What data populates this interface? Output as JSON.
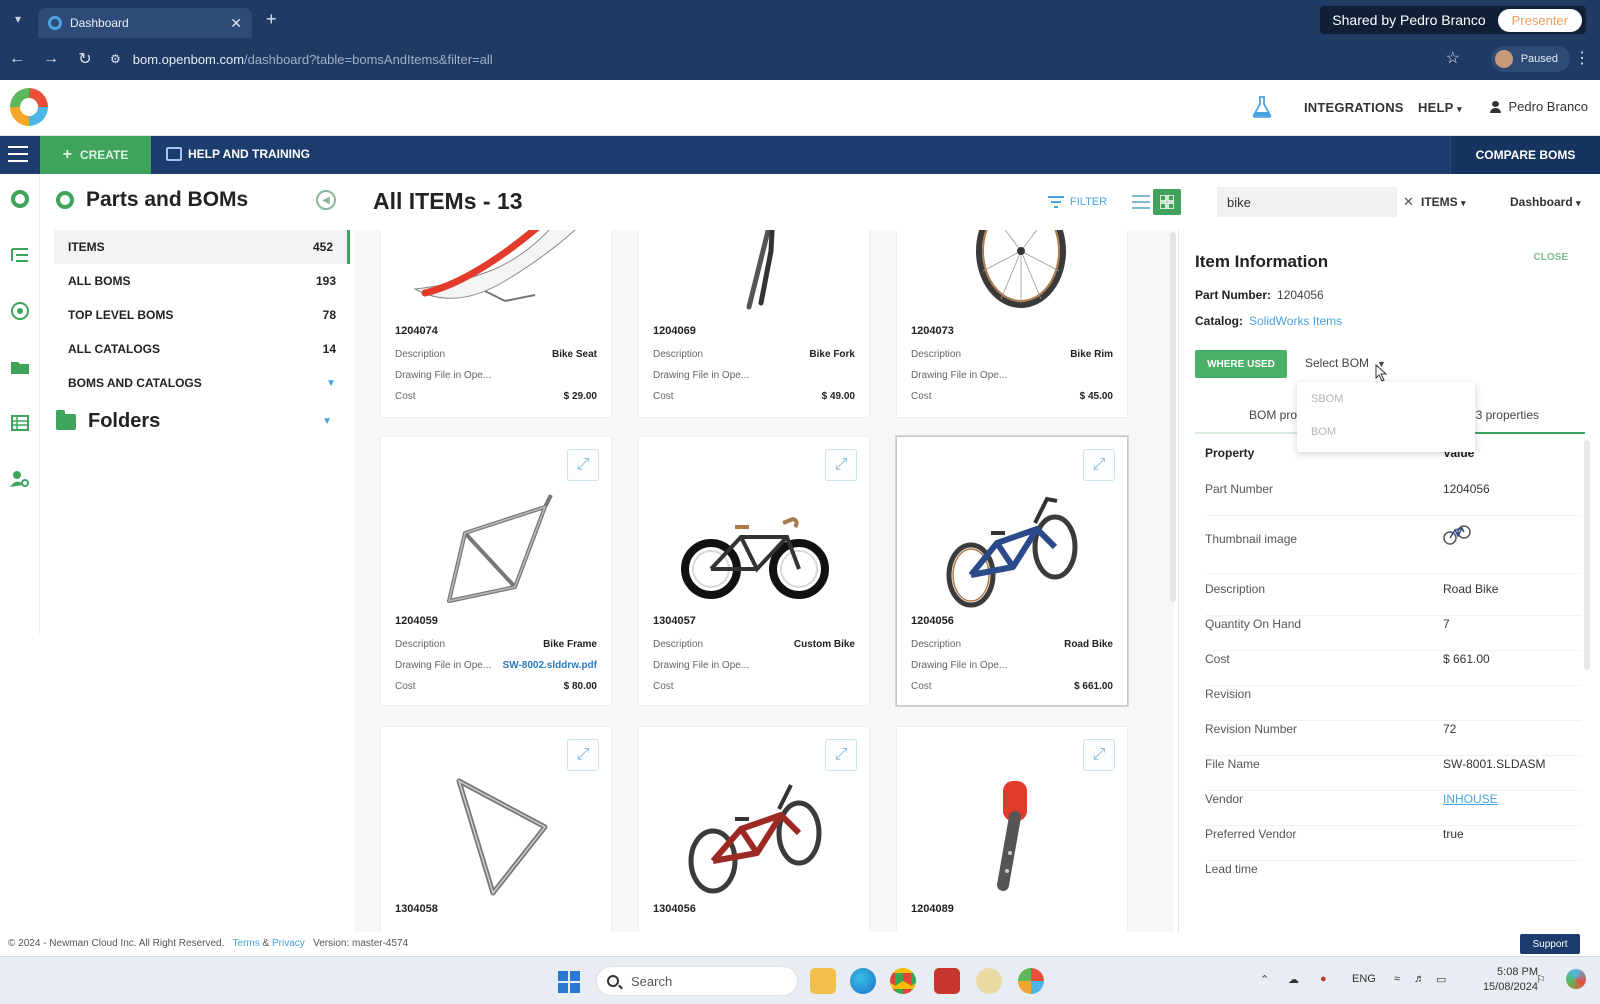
{
  "browser": {
    "tab_title": "Dashboard",
    "url_main": "bom.openbom.com",
    "url_rest": "/dashboard?table=bomsAndItems&filter=all",
    "shared_by": "Shared by Pedro Branco",
    "presenter": "Presenter",
    "profile_status": "Paused"
  },
  "header": {
    "integrations": "INTEGRATIONS",
    "help": "HELP",
    "user": "Pedro Branco"
  },
  "toolbar": {
    "create": "CREATE",
    "help_training": "HELP AND TRAINING",
    "compare_boms": "COMPARE BOMS"
  },
  "sidebar": {
    "title": "Parts and BOMs",
    "items": [
      {
        "label": "ITEMS",
        "count": "452"
      },
      {
        "label": "ALL BOMS",
        "count": "193"
      },
      {
        "label": "TOP LEVEL BOMS",
        "count": "78"
      },
      {
        "label": "ALL CATALOGS",
        "count": "14"
      },
      {
        "label": "BOMS AND CATALOGS",
        "count": ""
      }
    ],
    "folders": "Folders"
  },
  "main": {
    "title": "All ITEMs - 13",
    "filter": "FILTER",
    "search_value": "bike",
    "items_dd": "ITEMS",
    "dashboard_dd": "Dashboard"
  },
  "cards": [
    {
      "pn": "1204074",
      "desc": "Bike Seat",
      "drawing": "Drawing File in Ope...",
      "drawing_link": "",
      "cost": "$ 29.00"
    },
    {
      "pn": "1204069",
      "desc": "Bike Fork",
      "drawing": "Drawing File in Ope...",
      "drawing_link": "",
      "cost": "$ 49.00"
    },
    {
      "pn": "1204073",
      "desc": "Bike Rim",
      "drawing": "Drawing File in Ope...",
      "drawing_link": "",
      "cost": "$ 45.00"
    },
    {
      "pn": "1204059",
      "desc": "Bike Frame",
      "drawing": "Drawing File in Ope...",
      "drawing_link": "SW-8002.slddrw.pdf",
      "cost": "$ 80.00"
    },
    {
      "pn": "1304057",
      "desc": "Custom Bike",
      "drawing": "Drawing File in Ope...",
      "drawing_link": "",
      "cost": ""
    },
    {
      "pn": "1204056",
      "desc": "Road Bike",
      "drawing": "Drawing File in Ope...",
      "drawing_link": "",
      "cost": "$ 661.00"
    },
    {
      "pn": "1304058"
    },
    {
      "pn": "1304056"
    },
    {
      "pn": "1204089"
    }
  ],
  "card_labels": {
    "description": "Description",
    "cost": "Cost"
  },
  "panel": {
    "title": "Item Information",
    "close": "CLOSE",
    "part_number_label": "Part Number:",
    "part_number": "1204056",
    "catalog_label": "Catalog:",
    "catalog": "SolidWorks Items",
    "where_used": "WHERE USED",
    "select_bom": "Select BOM",
    "menu": [
      "SBOM",
      "BOM"
    ],
    "tab_left": "BOM pro",
    "tab_right": "3 properties",
    "prop_header": "Property",
    "value_header": "Value",
    "properties": [
      {
        "k": "Part Number",
        "v": "1204056"
      },
      {
        "k": "Thumbnail image",
        "v": ""
      },
      {
        "k": "Description",
        "v": "Road Bike"
      },
      {
        "k": "Quantity On Hand",
        "v": "7"
      },
      {
        "k": "Cost",
        "v": "$ 661.00"
      },
      {
        "k": "Revision",
        "v": ""
      },
      {
        "k": "Revision Number",
        "v": "72"
      },
      {
        "k": "File Name",
        "v": "SW-8001.SLDASM"
      },
      {
        "k": "Vendor",
        "v": "INHOUSE"
      },
      {
        "k": "Preferred Vendor",
        "v": "true"
      },
      {
        "k": "Lead time",
        "v": ""
      }
    ]
  },
  "footer": {
    "copyright": "© 2024 - Newman Cloud Inc. All Right Reserved.",
    "terms": "Terms",
    "amp": "&",
    "privacy": "Privacy",
    "version": "Version: master-4574",
    "support": "Support"
  },
  "taskbar": {
    "search": "Search",
    "lang": "ENG",
    "time": "5:08 PM",
    "date": "15/08/2024"
  },
  "colors": {
    "brand_green": "#3fa35c",
    "navy": "#1c3c6e",
    "link_blue": "#4aa3e0"
  }
}
